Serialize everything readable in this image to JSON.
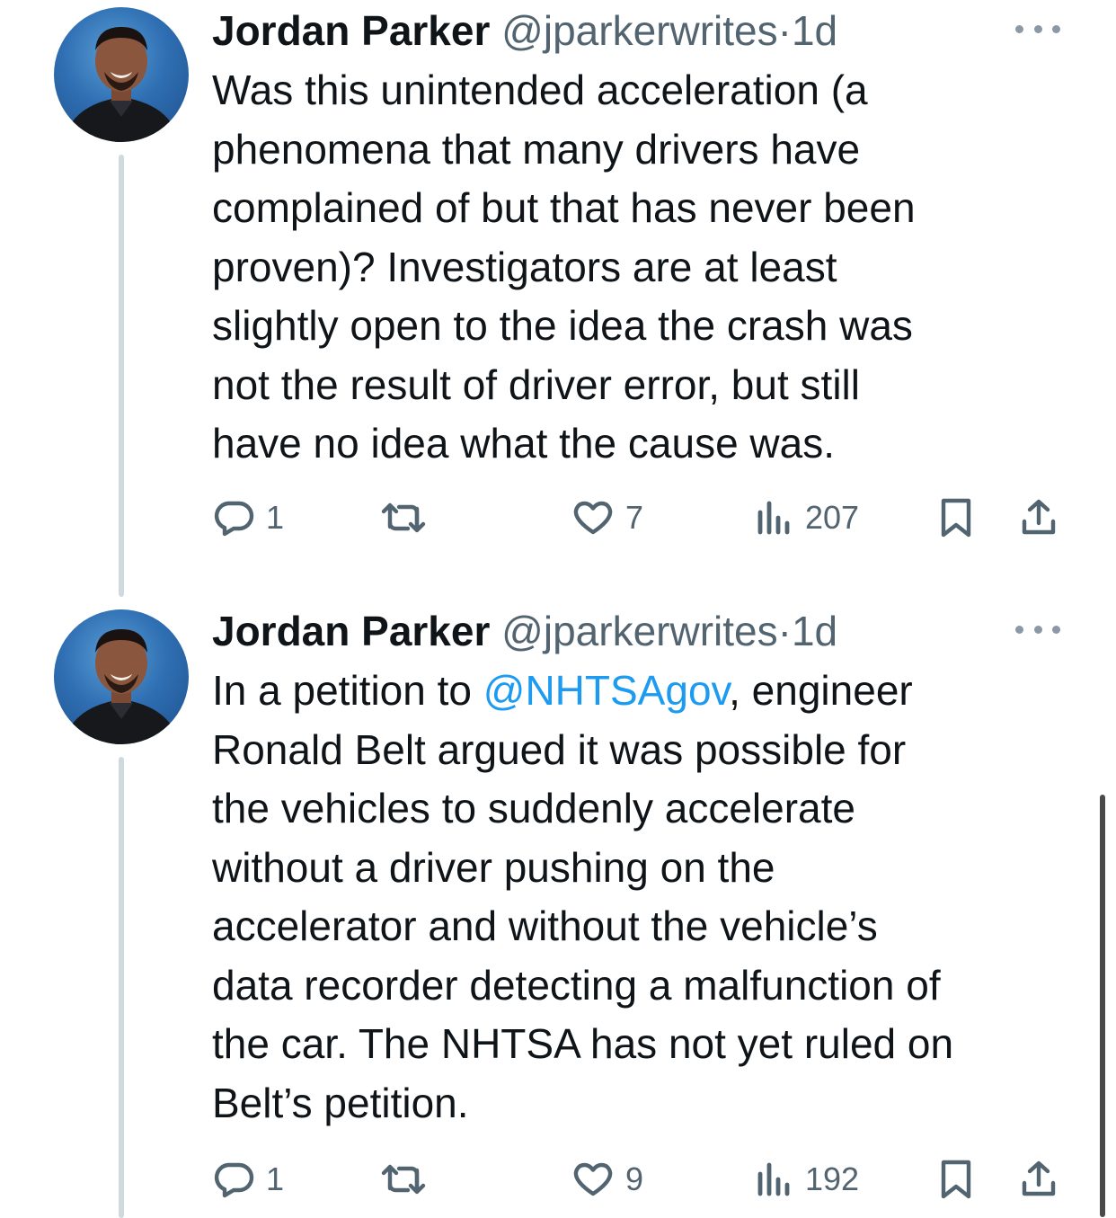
{
  "tweets": [
    {
      "author": {
        "name": "Jordan Parker",
        "handle": "@jparkerwrites",
        "separator": "·",
        "time": "1d"
      },
      "text_lines": [
        "Was this unintended acceleration (a",
        "phenomena that many drivers have",
        "complained of but that has never been",
        "proven)? Investigators are at least",
        "slightly open to the idea the crash was",
        "not the result of driver error, but still",
        "have no idea what the cause was."
      ],
      "actions": {
        "replies": "1",
        "retweets": "",
        "likes": "7",
        "views": "207"
      }
    },
    {
      "author": {
        "name": "Jordan Parker",
        "handle": "@jparkerwrites",
        "separator": "·",
        "time": "1d"
      },
      "text": {
        "line1_before": "In a petition to ",
        "mention": "@NHTSAgov",
        "line1_after": ", engineer",
        "lines": [
          "Ronald Belt argued it was possible for",
          "the vehicles to suddenly accelerate",
          "without a driver pushing on the",
          "accelerator and without the vehicle’s",
          "data recorder detecting a malfunction of",
          "the car. The NHTSA has not yet ruled on",
          "Belt’s petition."
        ]
      },
      "actions": {
        "replies": "1",
        "retweets": "",
        "likes": "9",
        "views": "192"
      }
    }
  ],
  "icons": {
    "reply": "reply-icon",
    "retweet": "retweet-icon",
    "like": "heart-icon",
    "views": "views-icon",
    "bookmark": "bookmark-icon",
    "share": "share-icon",
    "more": "more-options-icon"
  },
  "colors": {
    "text": "#0f1419",
    "secondary": "#536471",
    "link": "#1d9bf0",
    "thread_line": "#cfd9de"
  }
}
